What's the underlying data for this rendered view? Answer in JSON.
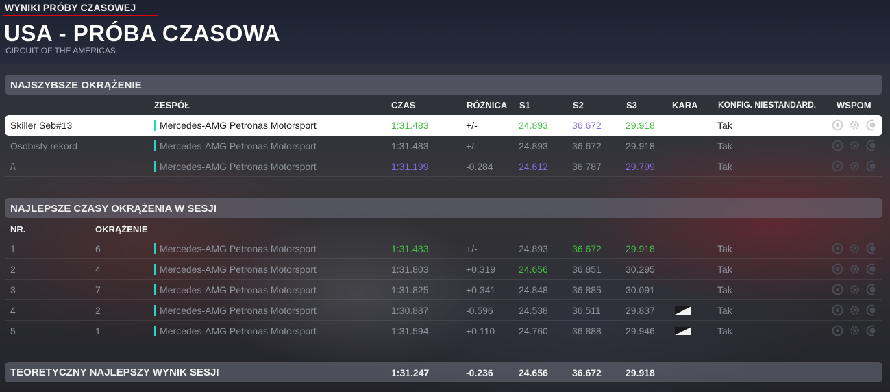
{
  "header": {
    "breadcrumb": "WYNIKI PRÓBY CZASOWEJ",
    "title": "USA - PRÓBA CZASOWA",
    "subtitle": "CIRCUIT OF THE AMERICAS"
  },
  "fastest": {
    "section_title": "NAJSZYBSZE OKRĄŻENIE",
    "headers": {
      "team": "ZESPÓŁ",
      "time": "CZAS",
      "diff": "RÓŻNICA",
      "s1": "S1",
      "s2": "S2",
      "s3": "S3",
      "penalty": "KARA",
      "config": "KONFIG. NIESTANDARD.",
      "assist": "WSPOM"
    },
    "rows": [
      {
        "name": "Skiller Seb#13",
        "team": "Mercedes-AMG Petronas Motorsport",
        "time": "1:31.483",
        "diff": "+/-",
        "s1": "24.893",
        "s2": "36.672",
        "s3": "29.918",
        "config": "Tak"
      },
      {
        "name": "Osobisty rekord",
        "team": "Mercedes-AMG Petronas Motorsport",
        "time": "1:31.483",
        "diff": "+/-",
        "s1": "24.893",
        "s2": "36.672",
        "s3": "29.918",
        "config": "Tak"
      },
      {
        "name": "/\\",
        "team": "Mercedes-AMG Petronas Motorsport",
        "time": "1:31.199",
        "diff": "-0.284",
        "s1": "24.612",
        "s2": "36.787",
        "s3": "29.799",
        "config": "Tak"
      }
    ]
  },
  "session": {
    "section_title": "NAJLEPSZE CZASY OKRĄŻENIA W SESJI",
    "headers": {
      "nr": "NR.",
      "lap": "OKRĄŻENIE"
    },
    "rows": [
      {
        "nr": "1",
        "lap": "6",
        "team": "Mercedes-AMG Petronas Motorsport",
        "time": "1:31.483",
        "diff": "+/-",
        "s1": "24.893",
        "s2": "36.672",
        "s3": "29.918",
        "config": "Tak"
      },
      {
        "nr": "2",
        "lap": "4",
        "team": "Mercedes-AMG Petronas Motorsport",
        "time": "1:31.803",
        "diff": "+0.319",
        "s1": "24.656",
        "s2": "36.851",
        "s3": "30.295",
        "config": "Tak"
      },
      {
        "nr": "3",
        "lap": "7",
        "team": "Mercedes-AMG Petronas Motorsport",
        "time": "1:31.825",
        "diff": "+0.341",
        "s1": "24.848",
        "s2": "36.885",
        "s3": "30.091",
        "config": "Tak"
      },
      {
        "nr": "4",
        "lap": "2",
        "team": "Mercedes-AMG Petronas Motorsport",
        "time": "1:30.887",
        "diff": "-0.596",
        "s1": "24.538",
        "s2": "36.511",
        "s3": "29.837",
        "config": "Tak"
      },
      {
        "nr": "5",
        "lap": "1",
        "team": "Mercedes-AMG Petronas Motorsport",
        "time": "1:31.594",
        "diff": "+0.110",
        "s1": "24.760",
        "s2": "36.888",
        "s3": "29.946",
        "config": "Tak"
      }
    ]
  },
  "theoretical": {
    "label": "TEORETYCZNY NAJLEPSZY WYNIK SESJI",
    "time": "1:31.247",
    "diff": "-0.236",
    "s1": "24.656",
    "s2": "36.672",
    "s3": "29.918"
  },
  "colors": {
    "personal_best": "#44c046",
    "overall_best": "#8a6fe0",
    "team_accent": "#27d6be",
    "breadcrumb_underline": "#e10600"
  },
  "icons": {
    "assist_icons": [
      "steering-assist-icon",
      "gear-icon",
      "braking-assist-icon"
    ],
    "penalty": "track-limits-flag-icon"
  }
}
